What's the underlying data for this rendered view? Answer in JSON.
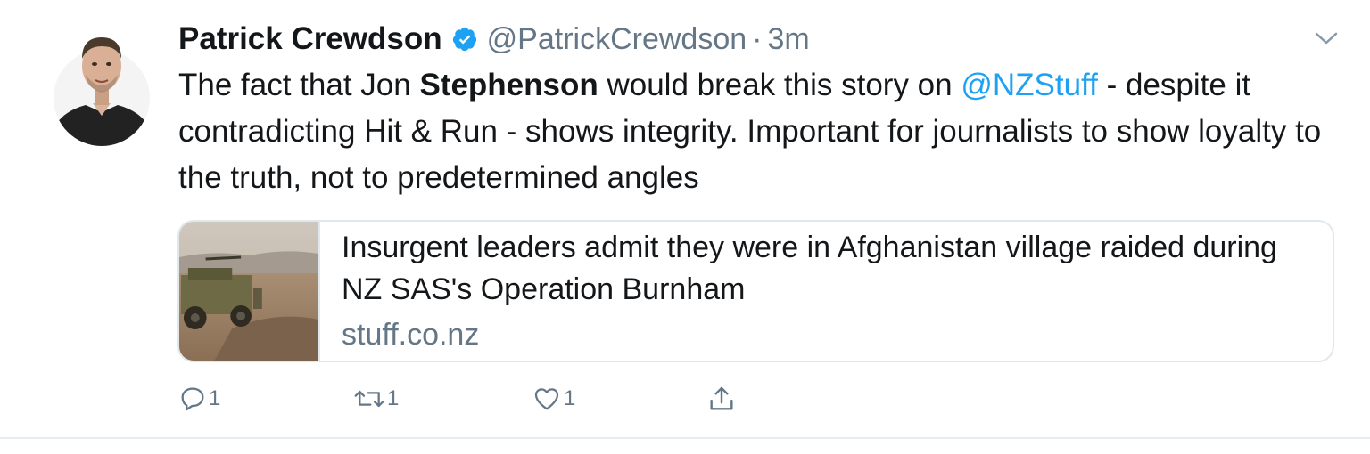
{
  "tweet": {
    "author_name": "Patrick Crewdson",
    "handle": "@PatrickCrewdson",
    "separator": "·",
    "timestamp": "3m",
    "text": {
      "part1": "The fact that Jon ",
      "bold": "Stephenson",
      "part2": " would break this story on ",
      "mention": "@NZStuff",
      "part3": " - despite it contradicting Hit & Run - shows integrity. Important for journalists to show loyalty to the truth, not to predetermined angles"
    },
    "card": {
      "title": "Insurgent leaders admit they were in Afghanistan village raided during NZ SAS's Operation Burnham",
      "domain": "stuff.co.nz"
    },
    "actions": {
      "reply_count": "1",
      "retweet_count": "1",
      "like_count": "1"
    }
  },
  "colors": {
    "text": "#14171a",
    "secondary": "#657786",
    "accent": "#1da1f2",
    "border": "#e1e8ed"
  },
  "icons": {
    "verified": "verified-badge-icon",
    "caret": "chevron-down-icon",
    "reply": "reply-icon",
    "retweet": "retweet-icon",
    "like": "heart-icon",
    "share": "share-icon"
  }
}
